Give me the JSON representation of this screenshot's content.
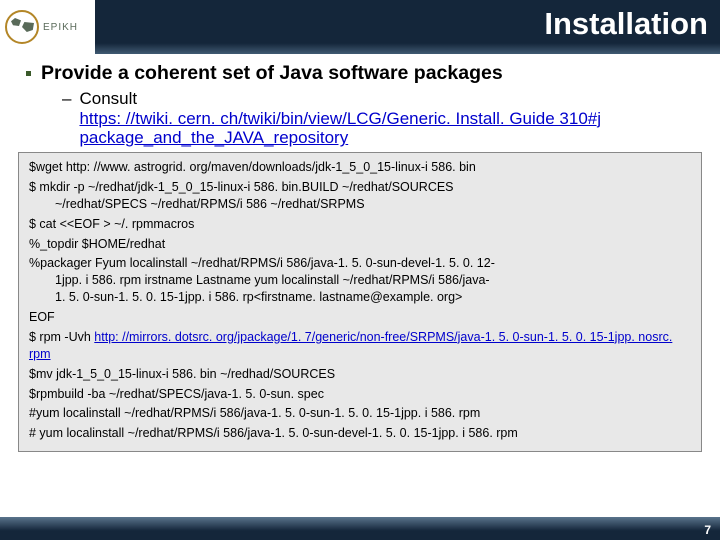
{
  "header": {
    "logo_text": "EPIKH",
    "title": "Installation"
  },
  "bullet": {
    "main": "Provide a coherent set of Java software packages",
    "sub_label": "Consult",
    "sub_link": "https: //twiki. cern. ch/twiki/bin/view/LCG/Generic. Install. Guide 310#j package_and_the_JAVA_repository"
  },
  "code": {
    "l1": "$wget http: //www. astrogrid. org/maven/downloads/jdk-1_5_0_15-linux-i 586. bin",
    "l2a": "$ mkdir -p ~/redhat/jdk-1_5_0_15-linux-i 586. bin.BUILD ~/redhat/SOURCES",
    "l2b": "~/redhat/SPECS ~/redhat/RPMS/i 586 ~/redhat/SRPMS",
    "l3": "$ cat <<EOF > ~/. rpmmacros",
    "l4": "%_topdir $HOME/redhat",
    "l5a": "%packager Fyum localinstall ~/redhat/RPMS/i 586/java-1. 5. 0-sun-devel-1. 5. 0. 12-",
    "l5b": "1jpp. i 586. rpm irstname Lastname yum localinstall ~/redhat/RPMS/i 586/java-",
    "l5c": "1. 5. 0-sun-1. 5. 0. 15-1jpp. i 586. rp<firstname. lastname@example. org>",
    "l6": "EOF",
    "l7a": "$ rpm -Uvh ",
    "l7link": "http: //mirrors. dotsrc. org/jpackage/1. 7/generic/non-free/SRPMS/java-1. 5. 0-sun-1. 5. 0. 15-1jpp. nosrc. rpm",
    "l8": "$mv jdk-1_5_0_15-linux-i 586. bin ~/redhad/SOURCES",
    "l9": "$rpmbuild -ba ~/redhat/SPECS/java-1. 5. 0-sun. spec",
    "l10": "#yum localinstall ~/redhat/RPMS/i 586/java-1. 5. 0-sun-1. 5. 0. 15-1jpp. i 586. rpm",
    "l11": "# yum localinstall ~/redhat/RPMS/i 586/java-1. 5. 0-sun-devel-1. 5. 0. 15-1jpp. i 586. rpm"
  },
  "footer": {
    "page": "7"
  }
}
